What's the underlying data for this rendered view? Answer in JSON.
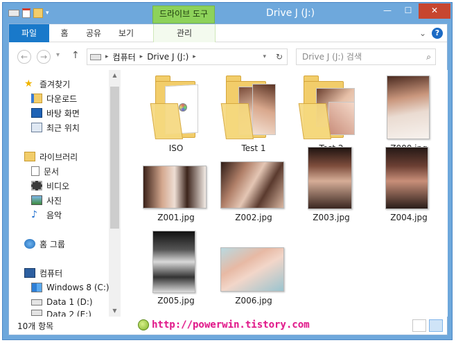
{
  "window": {
    "title": "Drive J (J:)",
    "contextual_tab_label": "드라이브 도구",
    "minimize_label": "—",
    "maximize_label": "☐",
    "close_label": "✕"
  },
  "ribbon": {
    "tabs": [
      "파일",
      "홈",
      "공유",
      "보기",
      "관리"
    ],
    "expand_label": "⌄",
    "help_label": "?"
  },
  "nav": {
    "back_label": "←",
    "forward_label": "→",
    "recent_label": "▾",
    "up_label": "↑",
    "refresh_label": "↻",
    "breadcrumb": [
      "컴퓨터",
      "Drive J (J:)"
    ],
    "breadcrumb_sep": "▸",
    "search_placeholder": "Drive J (J:) 검색",
    "search_icon": "⌕"
  },
  "sidebar": {
    "items": [
      {
        "label": "즐겨찾기",
        "icon": "star-icon"
      },
      {
        "label": "다운로드",
        "icon": "download-folder-icon"
      },
      {
        "label": "바탕 화면",
        "icon": "desktop-icon"
      },
      {
        "label": "최근 위치",
        "icon": "recent-places-icon"
      },
      {
        "label": "라이브러리",
        "icon": "library-icon"
      },
      {
        "label": "문서",
        "icon": "document-icon"
      },
      {
        "label": "비디오",
        "icon": "video-icon"
      },
      {
        "label": "사진",
        "icon": "pictures-icon"
      },
      {
        "label": "음악",
        "icon": "music-icon"
      },
      {
        "label": "홈 그룹",
        "icon": "homegroup-icon"
      },
      {
        "label": "컴퓨터",
        "icon": "computer-icon"
      },
      {
        "label": "Windows 8 (C:)",
        "icon": "windows-drive-icon"
      },
      {
        "label": "Data 1 (D:)",
        "icon": "drive-icon"
      },
      {
        "label": "Data 2 (E:)",
        "icon": "drive-icon"
      }
    ]
  },
  "files": [
    {
      "name": "ISO",
      "kind": "folder"
    },
    {
      "name": "Test 1",
      "kind": "folder"
    },
    {
      "name": "Test 2",
      "kind": "folder"
    },
    {
      "name": "Z000.jpg",
      "kind": "image"
    },
    {
      "name": "Z001.jpg",
      "kind": "image"
    },
    {
      "name": "Z002.jpg",
      "kind": "image"
    },
    {
      "name": "Z003.jpg",
      "kind": "image"
    },
    {
      "name": "Z004.jpg",
      "kind": "image"
    },
    {
      "name": "Z005.jpg",
      "kind": "image"
    },
    {
      "name": "Z006.jpg",
      "kind": "image"
    }
  ],
  "status": {
    "item_count": "10개 항목",
    "watermark": "http://powerwin.tistory.com"
  },
  "colors": {
    "accent": "#1979ca",
    "contextual_tab": "#8dd25a",
    "close_button": "#c7462f",
    "watermark": "#e01a8a"
  }
}
